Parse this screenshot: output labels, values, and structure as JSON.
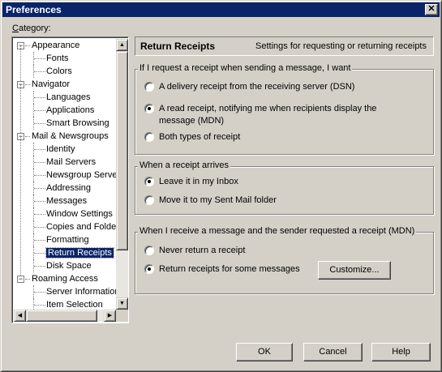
{
  "window": {
    "title": "Preferences",
    "close_glyph": "✕"
  },
  "category_label": "Category:",
  "tree": [
    {
      "label": "Appearance",
      "level": 0,
      "expander": "−"
    },
    {
      "label": "Fonts",
      "level": 1
    },
    {
      "label": "Colors",
      "level": 1
    },
    {
      "label": "Navigator",
      "level": 0,
      "expander": "−"
    },
    {
      "label": "Languages",
      "level": 1
    },
    {
      "label": "Applications",
      "level": 1
    },
    {
      "label": "Smart Browsing",
      "level": 1
    },
    {
      "label": "Mail & Newsgroups",
      "level": 0,
      "expander": "−"
    },
    {
      "label": "Identity",
      "level": 1
    },
    {
      "label": "Mail Servers",
      "level": 1
    },
    {
      "label": "Newsgroup Serve",
      "level": 1
    },
    {
      "label": "Addressing",
      "level": 1
    },
    {
      "label": "Messages",
      "level": 1
    },
    {
      "label": "Window Settings",
      "level": 1
    },
    {
      "label": "Copies and Folder",
      "level": 1
    },
    {
      "label": "Formatting",
      "level": 1
    },
    {
      "label": "Return Receipts",
      "level": 1,
      "selected": true
    },
    {
      "label": "Disk Space",
      "level": 1
    },
    {
      "label": "Roaming Access",
      "level": 0,
      "expander": "−"
    },
    {
      "label": "Server Informatior",
      "level": 1
    },
    {
      "label": "Item Selection",
      "level": 1
    }
  ],
  "header": {
    "title": "Return Receipts",
    "description": "Settings for requesting or returning receipts"
  },
  "group_request": {
    "label": "If I request a receipt when sending a message, I want",
    "options": [
      {
        "text": "A delivery receipt from the receiving server (DSN)",
        "checked": false
      },
      {
        "text_line1": "A read receipt, notifying me when recipients display the",
        "text_line2": "message (MDN)",
        "checked": true
      },
      {
        "text": "Both types of receipt",
        "checked": false
      }
    ]
  },
  "group_arrives": {
    "label": "When a receipt arrives",
    "options": [
      {
        "text": "Leave it in my Inbox",
        "checked": true
      },
      {
        "text": "Move it to my Sent Mail folder",
        "checked": false
      }
    ]
  },
  "group_mdn": {
    "label": "When I receive a message and the sender requested a receipt (MDN)",
    "options": [
      {
        "text": "Never return a receipt",
        "checked": false
      },
      {
        "text": "Return receipts for some messages",
        "checked": true
      }
    ],
    "customize_label": "Customize..."
  },
  "buttons": {
    "ok": "OK",
    "cancel": "Cancel",
    "help": "Help"
  },
  "scroll_arrows": {
    "up": "▲",
    "down": "▼",
    "left": "◀",
    "right": "▶"
  }
}
